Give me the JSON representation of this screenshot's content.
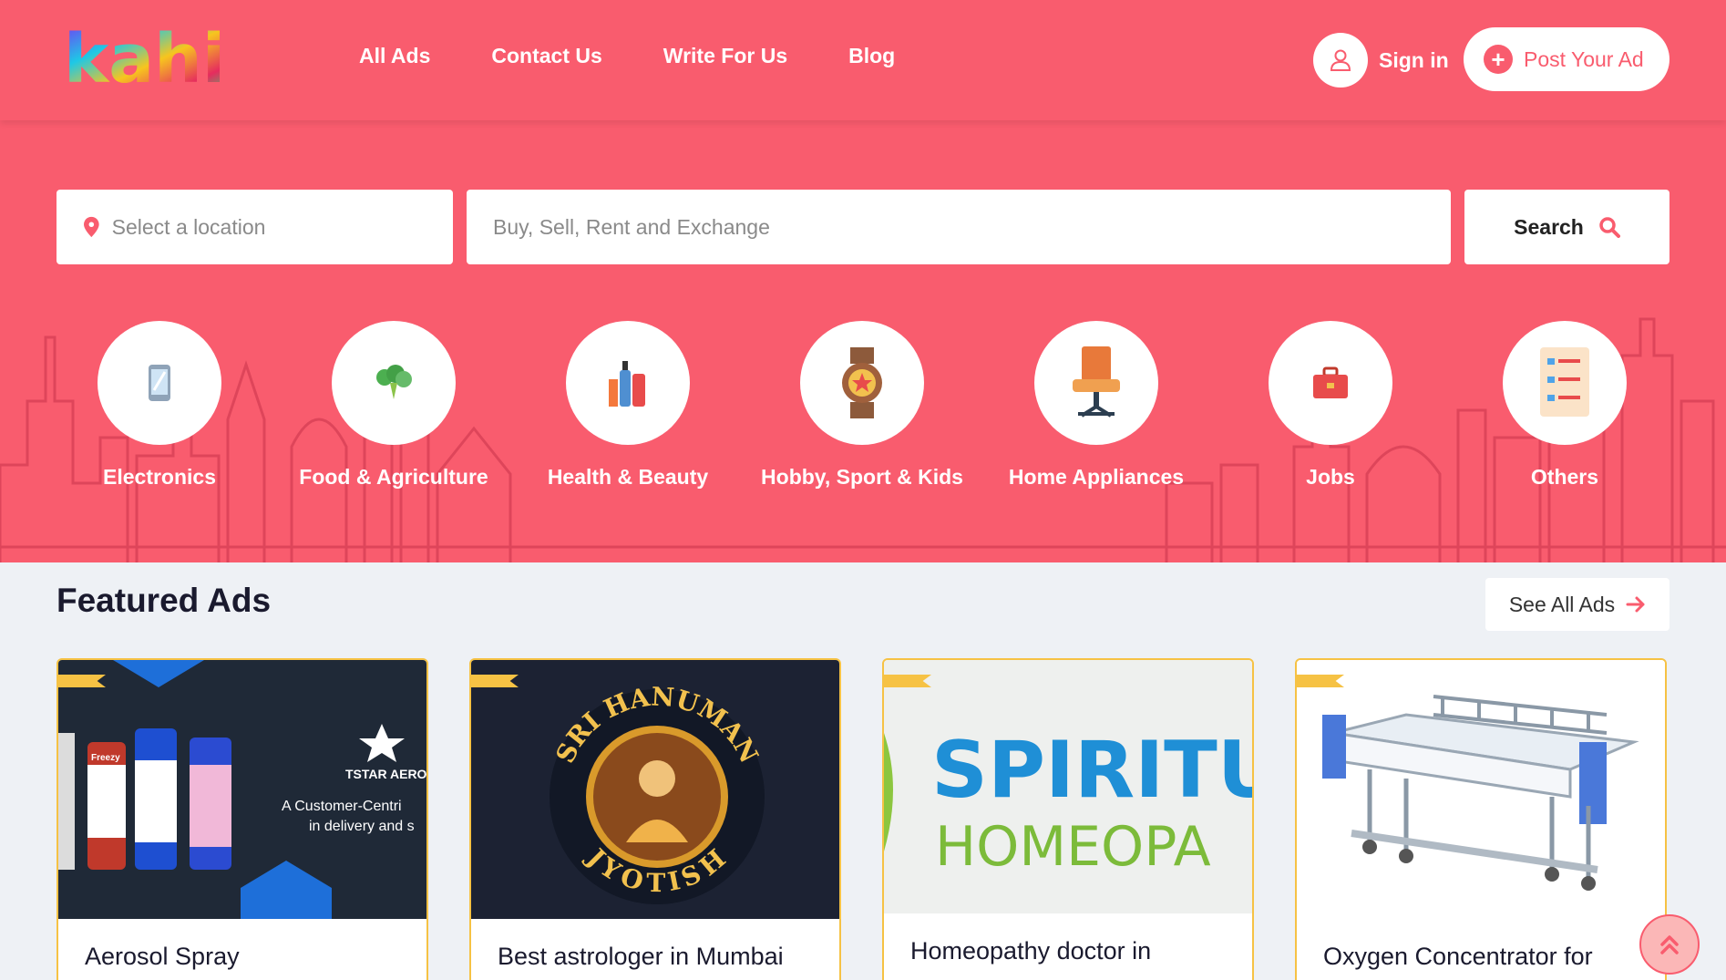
{
  "brand": {
    "logo_text": "kahi",
    "accent": "#f95c6e",
    "badge": "#f6c244"
  },
  "nav": {
    "items": [
      "All Ads",
      "Contact Us",
      "Write For Us",
      "Blog"
    ]
  },
  "auth": {
    "signin_label": "Sign in",
    "post_label": "Post Your Ad"
  },
  "search": {
    "location_placeholder": "Select a location",
    "query_placeholder": "Buy, Sell, Rent and Exchange",
    "button_label": "Search"
  },
  "categories": [
    {
      "label": "Electronics",
      "icon": "phone-icon"
    },
    {
      "label": "Food & Agriculture",
      "icon": "broccoli-icon"
    },
    {
      "label": "Health & Beauty",
      "icon": "cosmetics-icon"
    },
    {
      "label": "Hobby, Sport & Kids",
      "icon": "medal-icon"
    },
    {
      "label": "Home Appliances",
      "icon": "chair-icon"
    },
    {
      "label": "Jobs",
      "icon": "briefcase-icon"
    },
    {
      "label": "Others",
      "icon": "list-icon"
    }
  ],
  "featured": {
    "title": "Featured Ads",
    "see_all_label": "See All Ads",
    "cards": [
      {
        "title": "Aerosol Spray",
        "brand_text": "TSTAR AEROS",
        "tagline_1": "A Customer-Centri",
        "tagline_2": "in delivery and s",
        "can_label": "Freezy"
      },
      {
        "title": "Best astrologer in Mumbai",
        "arc_top": "SRI HANUMAN",
        "arc_bottom": "JYOTISH"
      },
      {
        "title": "Homeopathy doctor in",
        "word_1": "SPIRITU",
        "word_2": "HOMEOPA"
      },
      {
        "title": "Oxygen Concentrator for"
      }
    ]
  }
}
